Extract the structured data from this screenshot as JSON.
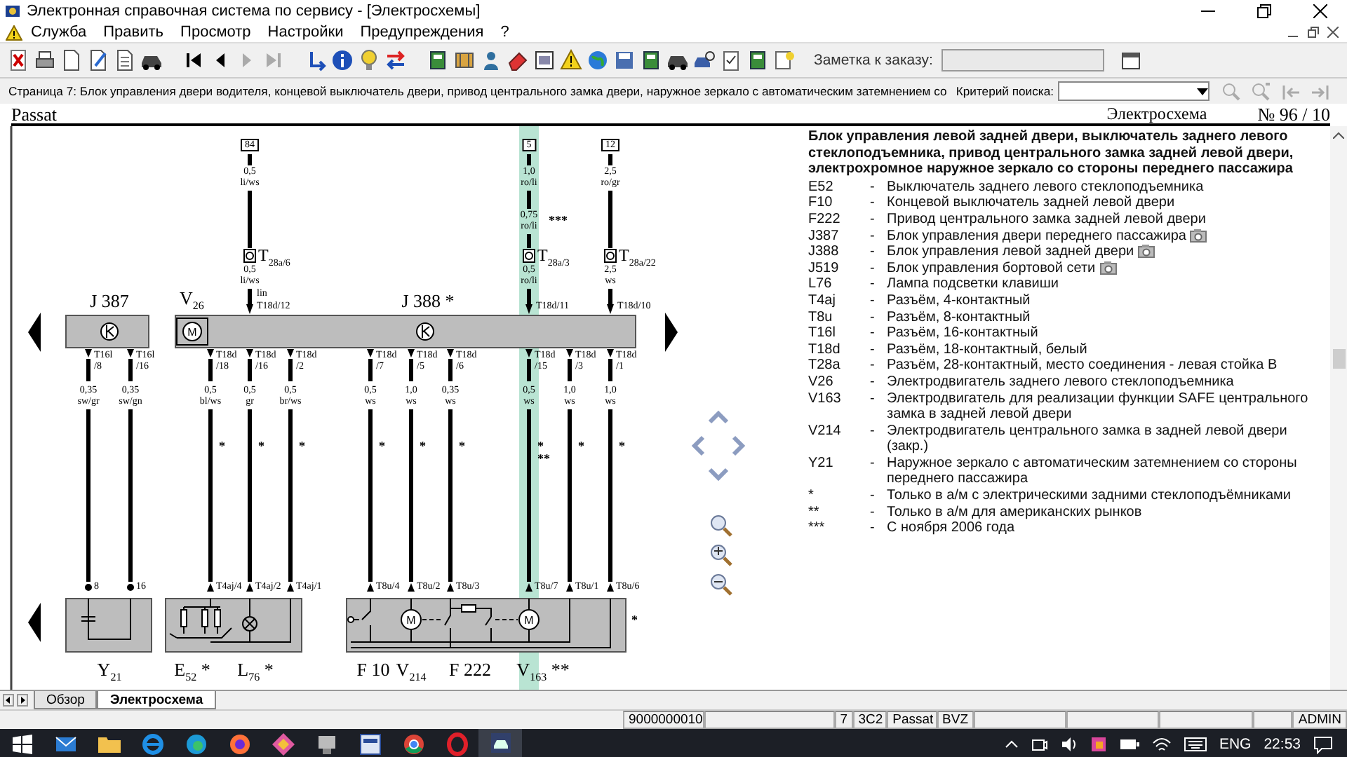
{
  "window": {
    "title": "Электронная справочная система по сервису - [Электросхемы]"
  },
  "menu": [
    {
      "label": "Служба"
    },
    {
      "label": "Править"
    },
    {
      "label": "Просмотр"
    },
    {
      "label": "Настройки"
    },
    {
      "label": "Предупреждения"
    },
    {
      "label": "?"
    }
  ],
  "toolbar": {
    "page_nav": [
      {
        "kind": "first",
        "disabled": false
      },
      {
        "kind": "previous",
        "disabled": false
      },
      {
        "kind": "next",
        "disabled": true
      },
      {
        "kind": "last",
        "disabled": true
      }
    ],
    "note_label": "Заметка к заказу:"
  },
  "infobar": {
    "page_text": "Страница 7: Блок управления двери водителя, концевой выключатель двери, привод центрального замка двери, наружное зеркало с автоматическим затемнением со",
    "search_label": "Критерий поиска:",
    "search_buttons": [
      {
        "kind": "find",
        "disabled": true
      },
      {
        "kind": "find_next",
        "disabled": true
      },
      {
        "kind": "back",
        "disabled": true
      },
      {
        "kind": "forward",
        "disabled": true
      }
    ]
  },
  "diagram": {
    "model": "Passat",
    "title": "Электросхема",
    "number": "№ 96 / 10",
    "top_wires": [
      {
        "fuse": "84",
        "segments": [
          {
            "gauge": "0,5",
            "insulation": "li/ws"
          }
        ],
        "connector": "T$_{28a/6}$",
        "lower": {
          "gauge": "0,5",
          "insulation": "li/ws"
        },
        "pin_note": "lin",
        "pin": "T18d/12",
        "highlighted": false
      },
      {
        "fuse": "5",
        "segments": [
          {
            "gauge": "1,0",
            "insulation": "ro/li"
          },
          {
            "gauge": "0,75",
            "insulation": "ro/li",
            "note": "***"
          }
        ],
        "connector": "T$_{28a/3}$",
        "lower": {
          "gauge": "0,5",
          "insulation": "ro/li"
        },
        "pin": "T18d/11",
        "highlighted": true
      },
      {
        "fuse": "12",
        "segments": [
          {
            "gauge": "2,5",
            "insulation": "ro/gr"
          }
        ],
        "connector": "T$_{28a/22}$",
        "lower": {
          "gauge": "2,5",
          "insulation": "ws"
        },
        "pin": "T18d/10",
        "highlighted": false
      }
    ],
    "upper_units": [
      {
        "kind": "control_unit",
        "label": "J 387"
      },
      {
        "kind": "motor",
        "label": "V$_{26}$",
        "symbol": "M"
      },
      {
        "kind": "control_unit",
        "label": "J 388 *"
      }
    ],
    "bottom_wires": [
      {
        "pin": "T16l /8",
        "gauge": "0,35",
        "insulation": "sw/gr",
        "end_pin": "8",
        "kind": "dot",
        "highlighted": false
      },
      {
        "pin": "T16l /16",
        "gauge": "0,35",
        "insulation": "sw/gn",
        "end_pin": "16",
        "kind": "dot",
        "highlighted": false
      },
      {
        "pin": "T18d /18",
        "gauge": "0,5",
        "insulation": "bl/ws",
        "notes": [
          "*"
        ],
        "end_pin": "T4aj/4",
        "kind": "arrow",
        "highlighted": false
      },
      {
        "pin": "T18d /16",
        "gauge": "0,5",
        "insulation": "gr",
        "notes": [
          "*"
        ],
        "end_pin": "T4aj/2",
        "kind": "arrow",
        "highlighted": false
      },
      {
        "pin": "T18d /2",
        "gauge": "0,5",
        "insulation": "br/ws",
        "notes": [
          "*"
        ],
        "end_pin": "T4aj/1",
        "kind": "arrow",
        "highlighted": false
      },
      {
        "pin": "T18d /7",
        "gauge": "0,5",
        "insulation": "ws",
        "notes": [
          "*"
        ],
        "end_pin": "T8u/4",
        "kind": "arrow",
        "highlighted": false
      },
      {
        "pin": "T18d /5",
        "gauge": "1,0",
        "insulation": "ws",
        "notes": [
          "*"
        ],
        "end_pin": "T8u/2",
        "kind": "arrow",
        "highlighted": false
      },
      {
        "pin": "T18d /6",
        "gauge": "0,35",
        "insulation": "ws",
        "notes": [
          "*"
        ],
        "end_pin": "T8u/3",
        "kind": "arrow",
        "highlighted": false
      },
      {
        "pin": "T18d /15",
        "gauge": "0,5",
        "insulation": "ws",
        "notes": [
          "*",
          "**"
        ],
        "end_pin": "T8u/7",
        "kind": "arrow",
        "highlighted": true
      },
      {
        "pin": "T18d /3",
        "gauge": "1,0",
        "insulation": "ws",
        "notes": [
          "*"
        ],
        "end_pin": "T8u/1",
        "kind": "arrow",
        "highlighted": false
      },
      {
        "pin": "T18d /1",
        "gauge": "1,0",
        "insulation": "ws",
        "notes": [
          "*"
        ],
        "end_pin": "T8u/6",
        "kind": "arrow",
        "highlighted": false
      }
    ],
    "lower_groups": [
      {
        "parts": [
          {
            "kind": "mirror",
            "label": "Y$_{21}$"
          }
        ]
      },
      {
        "parts": [
          {
            "kind": "switch",
            "label": "E$_{52}$ *"
          },
          {
            "kind": "lamp",
            "label": "L$_{76}$ *"
          }
        ]
      },
      {
        "parts": [
          {
            "kind": "contact_switch",
            "label": "F 10"
          },
          {
            "kind": "motor",
            "label": "V$_{214}$",
            "symbol": "M"
          },
          {
            "kind": "lock_actuator",
            "label": "F 222"
          },
          {
            "kind": "motor",
            "label": "V$_{163}$ **",
            "symbol": "M"
          }
        ],
        "note": "*"
      }
    ]
  },
  "legend": {
    "title": "Блок управления левой задней двери, выключатель заднего левого стеклоподъемника, привод центрального замка задней левой двери, электрохромное наружное зеркало со стороны переднего пассажира",
    "entries": [
      {
        "code": "E52",
        "sep": "-",
        "text": "Выключатель заднего левого стеклоподъемника",
        "photo": false
      },
      {
        "code": "F10",
        "sep": "-",
        "text": "Концевой выключатель задней левой двери",
        "photo": false
      },
      {
        "code": "F222",
        "sep": "-",
        "text": "Привод центрального замка задней левой двери",
        "photo": false
      },
      {
        "code": "J387",
        "sep": "-",
        "text": "Блок управления двери переднего пассажира",
        "photo": true
      },
      {
        "code": "J388",
        "sep": "-",
        "text": "Блок управления левой задней двери",
        "photo": true
      },
      {
        "code": "J519",
        "sep": "-",
        "text": "Блок управления бортовой сети",
        "photo": true
      },
      {
        "code": "L76",
        "sep": "-",
        "text": "Лампа подсветки клавиши",
        "photo": false
      },
      {
        "code": "T4aj",
        "sep": "-",
        "text": "Разъём, 4-контактный",
        "photo": false
      },
      {
        "code": "T8u",
        "sep": "-",
        "text": "Разъём, 8-контактный",
        "photo": false
      },
      {
        "code": "T16l",
        "sep": "-",
        "text": "Разъём, 16-контактный",
        "photo": false
      },
      {
        "code": "T18d",
        "sep": "-",
        "text": "Разъём, 18-контактный, белый",
        "photo": false
      },
      {
        "code": "T28a",
        "sep": "-",
        "text": "Разъём, 28-контактный, место соединения - левая стойка B",
        "photo": false
      },
      {
        "code": "V26",
        "sep": "-",
        "text": "Электродвигатель заднего левого стеклоподъемника",
        "photo": false
      },
      {
        "code": "V163",
        "sep": "-",
        "text": "Электродвигатель для реализации функции SAFE центрального замка в задней левой двери",
        "photo": false
      },
      {
        "code": "V214",
        "sep": "-",
        "text": "Электродвигатель центрального замка в задней левой двери (закр.)",
        "photo": false
      },
      {
        "code": "Y21",
        "sep": "-",
        "text": "Наружное зеркало с автоматическим затемнением со стороны переднего пассажира",
        "photo": false
      },
      {
        "code": "*",
        "sep": "-",
        "text": "Только в а/м с электрическими задними стеклоподъёмниками",
        "photo": false
      },
      {
        "code": "**",
        "sep": "-",
        "text": "Только в а/м для американских рынков",
        "photo": false
      },
      {
        "code": "***",
        "sep": "-",
        "text": "С ноября 2006 года",
        "photo": false
      }
    ]
  },
  "tabs": [
    {
      "label": "Обзор",
      "selected": false
    },
    {
      "label": "Электросхема",
      "selected": true
    }
  ],
  "status_bar": {
    "cells": [
      "9000000010",
      "7",
      "3C2",
      "Passat",
      "BVZ",
      "ADMIN"
    ]
  },
  "taskbar": {
    "apps": [
      {
        "kind": "mail",
        "active": false
      },
      {
        "kind": "folder",
        "active": false
      },
      {
        "kind": "ie",
        "active": false
      },
      {
        "kind": "edge",
        "active": false
      },
      {
        "kind": "firefox",
        "active": false
      },
      {
        "kind": "tool",
        "active": false
      },
      {
        "kind": "network",
        "active": false
      },
      {
        "kind": "square",
        "active": false
      },
      {
        "kind": "chrome",
        "active": false
      },
      {
        "kind": "opera",
        "active": false
      },
      {
        "kind": "service",
        "active": true
      }
    ],
    "language": "ENG",
    "time": "22:53"
  }
}
